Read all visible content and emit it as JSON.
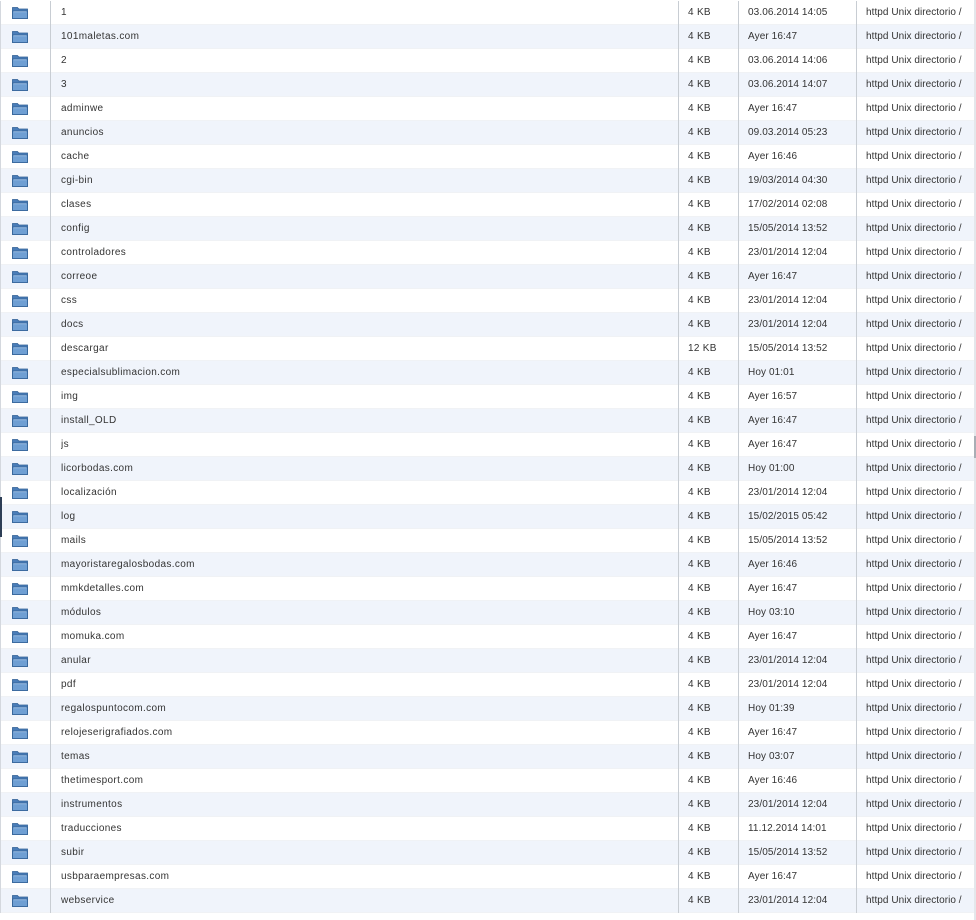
{
  "file_list": {
    "rows": [
      {
        "name": "1",
        "size": "4 KB",
        "modified": "03.06.2014 14:05",
        "type": "httpd Unix directorio /",
        "icon": "folder-icon"
      },
      {
        "name": "101maletas.com",
        "size": "4 KB",
        "modified": "Ayer 16:47",
        "type": "httpd Unix directorio /",
        "icon": "folder-icon"
      },
      {
        "name": "2",
        "size": "4 KB",
        "modified": "03.06.2014 14:06",
        "type": "httpd Unix directorio /",
        "icon": "folder-icon"
      },
      {
        "name": "3",
        "size": "4 KB",
        "modified": "03.06.2014 14:07",
        "type": "httpd Unix directorio /",
        "icon": "folder-icon"
      },
      {
        "name": "adminwe",
        "size": "4 KB",
        "modified": "Ayer 16:47",
        "type": "httpd Unix directorio /",
        "icon": "folder-icon"
      },
      {
        "name": "anuncios",
        "size": "4 KB",
        "modified": "09.03.2014 05:23",
        "type": "httpd Unix directorio /",
        "icon": "folder-icon"
      },
      {
        "name": "cache",
        "size": "4 KB",
        "modified": "Ayer 16:46",
        "type": "httpd Unix directorio /",
        "icon": "folder-icon"
      },
      {
        "name": "cgi-bin",
        "size": "4 KB",
        "modified": "19/03/2014 04:30",
        "type": "httpd Unix directorio /",
        "icon": "folder-icon"
      },
      {
        "name": "clases",
        "size": "4 KB",
        "modified": "17/02/2014 02:08",
        "type": "httpd Unix directorio /",
        "icon": "folder-icon"
      },
      {
        "name": "config",
        "size": "4 KB",
        "modified": "15/05/2014 13:52",
        "type": "httpd Unix directorio /",
        "icon": "folder-icon"
      },
      {
        "name": "controladores",
        "size": "4 KB",
        "modified": "23/01/2014 12:04",
        "type": "httpd Unix directorio /",
        "icon": "folder-icon"
      },
      {
        "name": "correoe",
        "size": "4 KB",
        "modified": "Ayer 16:47",
        "type": "httpd Unix directorio /",
        "icon": "folder-icon"
      },
      {
        "name": "css",
        "size": "4 KB",
        "modified": "23/01/2014 12:04",
        "type": "httpd Unix directorio /",
        "icon": "folder-icon"
      },
      {
        "name": "docs",
        "size": "4 KB",
        "modified": "23/01/2014 12:04",
        "type": "httpd Unix directorio /",
        "icon": "folder-icon"
      },
      {
        "name": "descargar",
        "size": "12 KB",
        "modified": "15/05/2014 13:52",
        "type": "httpd Unix directorio /",
        "icon": "folder-icon"
      },
      {
        "name": "especialsublimacion.com",
        "size": "4 KB",
        "modified": "Hoy 01:01",
        "type": "httpd Unix directorio /",
        "icon": "folder-icon"
      },
      {
        "name": "img",
        "size": "4 KB",
        "modified": "Ayer 16:57",
        "type": "httpd Unix directorio /",
        "icon": "folder-icon"
      },
      {
        "name": "install_OLD",
        "size": "4 KB",
        "modified": "Ayer 16:47",
        "type": "httpd Unix directorio /",
        "icon": "folder-icon"
      },
      {
        "name": "js",
        "size": "4 KB",
        "modified": "Ayer 16:47",
        "type": "httpd Unix directorio /",
        "icon": "folder-icon"
      },
      {
        "name": "licorbodas.com",
        "size": "4 KB",
        "modified": "Hoy 01:00",
        "type": "httpd Unix directorio /",
        "icon": "folder-icon"
      },
      {
        "name": "localización",
        "size": "4 KB",
        "modified": "23/01/2014 12:04",
        "type": "httpd Unix directorio /",
        "icon": "folder-icon"
      },
      {
        "name": "log",
        "size": "4 KB",
        "modified": "15/02/2015 05:42",
        "type": "httpd Unix directorio /",
        "icon": "folder-icon"
      },
      {
        "name": "mails",
        "size": "4 KB",
        "modified": "15/05/2014 13:52",
        "type": "httpd Unix directorio /",
        "icon": "folder-icon"
      },
      {
        "name": "mayoristaregalosbodas.com",
        "size": "4 KB",
        "modified": "Ayer 16:46",
        "type": "httpd Unix directorio /",
        "icon": "folder-icon"
      },
      {
        "name": "mmkdetalles.com",
        "size": "4 KB",
        "modified": "Ayer 16:47",
        "type": "httpd Unix directorio /",
        "icon": "folder-icon"
      },
      {
        "name": "módulos",
        "size": "4 KB",
        "modified": "Hoy 03:10",
        "type": "httpd Unix directorio /",
        "icon": "folder-icon"
      },
      {
        "name": "momuka.com",
        "size": "4 KB",
        "modified": "Ayer 16:47",
        "type": "httpd Unix directorio /",
        "icon": "folder-icon"
      },
      {
        "name": "anular",
        "size": "4 KB",
        "modified": "23/01/2014 12:04",
        "type": "httpd Unix directorio /",
        "icon": "folder-icon"
      },
      {
        "name": "pdf",
        "size": "4 KB",
        "modified": "23/01/2014 12:04",
        "type": "httpd Unix directorio /",
        "icon": "folder-icon"
      },
      {
        "name": "regalospuntocom.com",
        "size": "4 KB",
        "modified": "Hoy 01:39",
        "type": "httpd Unix directorio /",
        "icon": "folder-icon"
      },
      {
        "name": "relojeserigrafiados.com",
        "size": "4 KB",
        "modified": "Ayer 16:47",
        "type": "httpd Unix directorio /",
        "icon": "folder-icon"
      },
      {
        "name": "temas",
        "size": "4 KB",
        "modified": "Hoy 03:07",
        "type": "httpd Unix directorio /",
        "icon": "folder-icon"
      },
      {
        "name": "thetimesport.com",
        "size": "4 KB",
        "modified": "Ayer 16:46",
        "type": "httpd Unix directorio /",
        "icon": "folder-icon"
      },
      {
        "name": "instrumentos",
        "size": "4 KB",
        "modified": "23/01/2014 12:04",
        "type": "httpd Unix directorio /",
        "icon": "folder-icon"
      },
      {
        "name": "traducciones",
        "size": "4 KB",
        "modified": "11.12.2014 14:01",
        "type": "httpd Unix directorio /",
        "icon": "folder-icon"
      },
      {
        "name": "subir",
        "size": "4 KB",
        "modified": "15/05/2014 13:52",
        "type": "httpd Unix directorio /",
        "icon": "folder-icon"
      },
      {
        "name": "usbparaempresas.com",
        "size": "4 KB",
        "modified": "Ayer 16:47",
        "type": "httpd Unix directorio /",
        "icon": "folder-icon"
      },
      {
        "name": "webservice",
        "size": "4 KB",
        "modified": "23/01/2014 12:04",
        "type": "httpd Unix directorio /",
        "icon": "folder-icon"
      }
    ]
  },
  "colors": {
    "row_even": "#ffffff",
    "row_odd": "#f0f4fb",
    "column_separator": "#c8cdd3",
    "text": "#333333",
    "folder_front": "#6f9fd3",
    "folder_back": "#4a7db8",
    "folder_outline": "#2f5f95"
  }
}
